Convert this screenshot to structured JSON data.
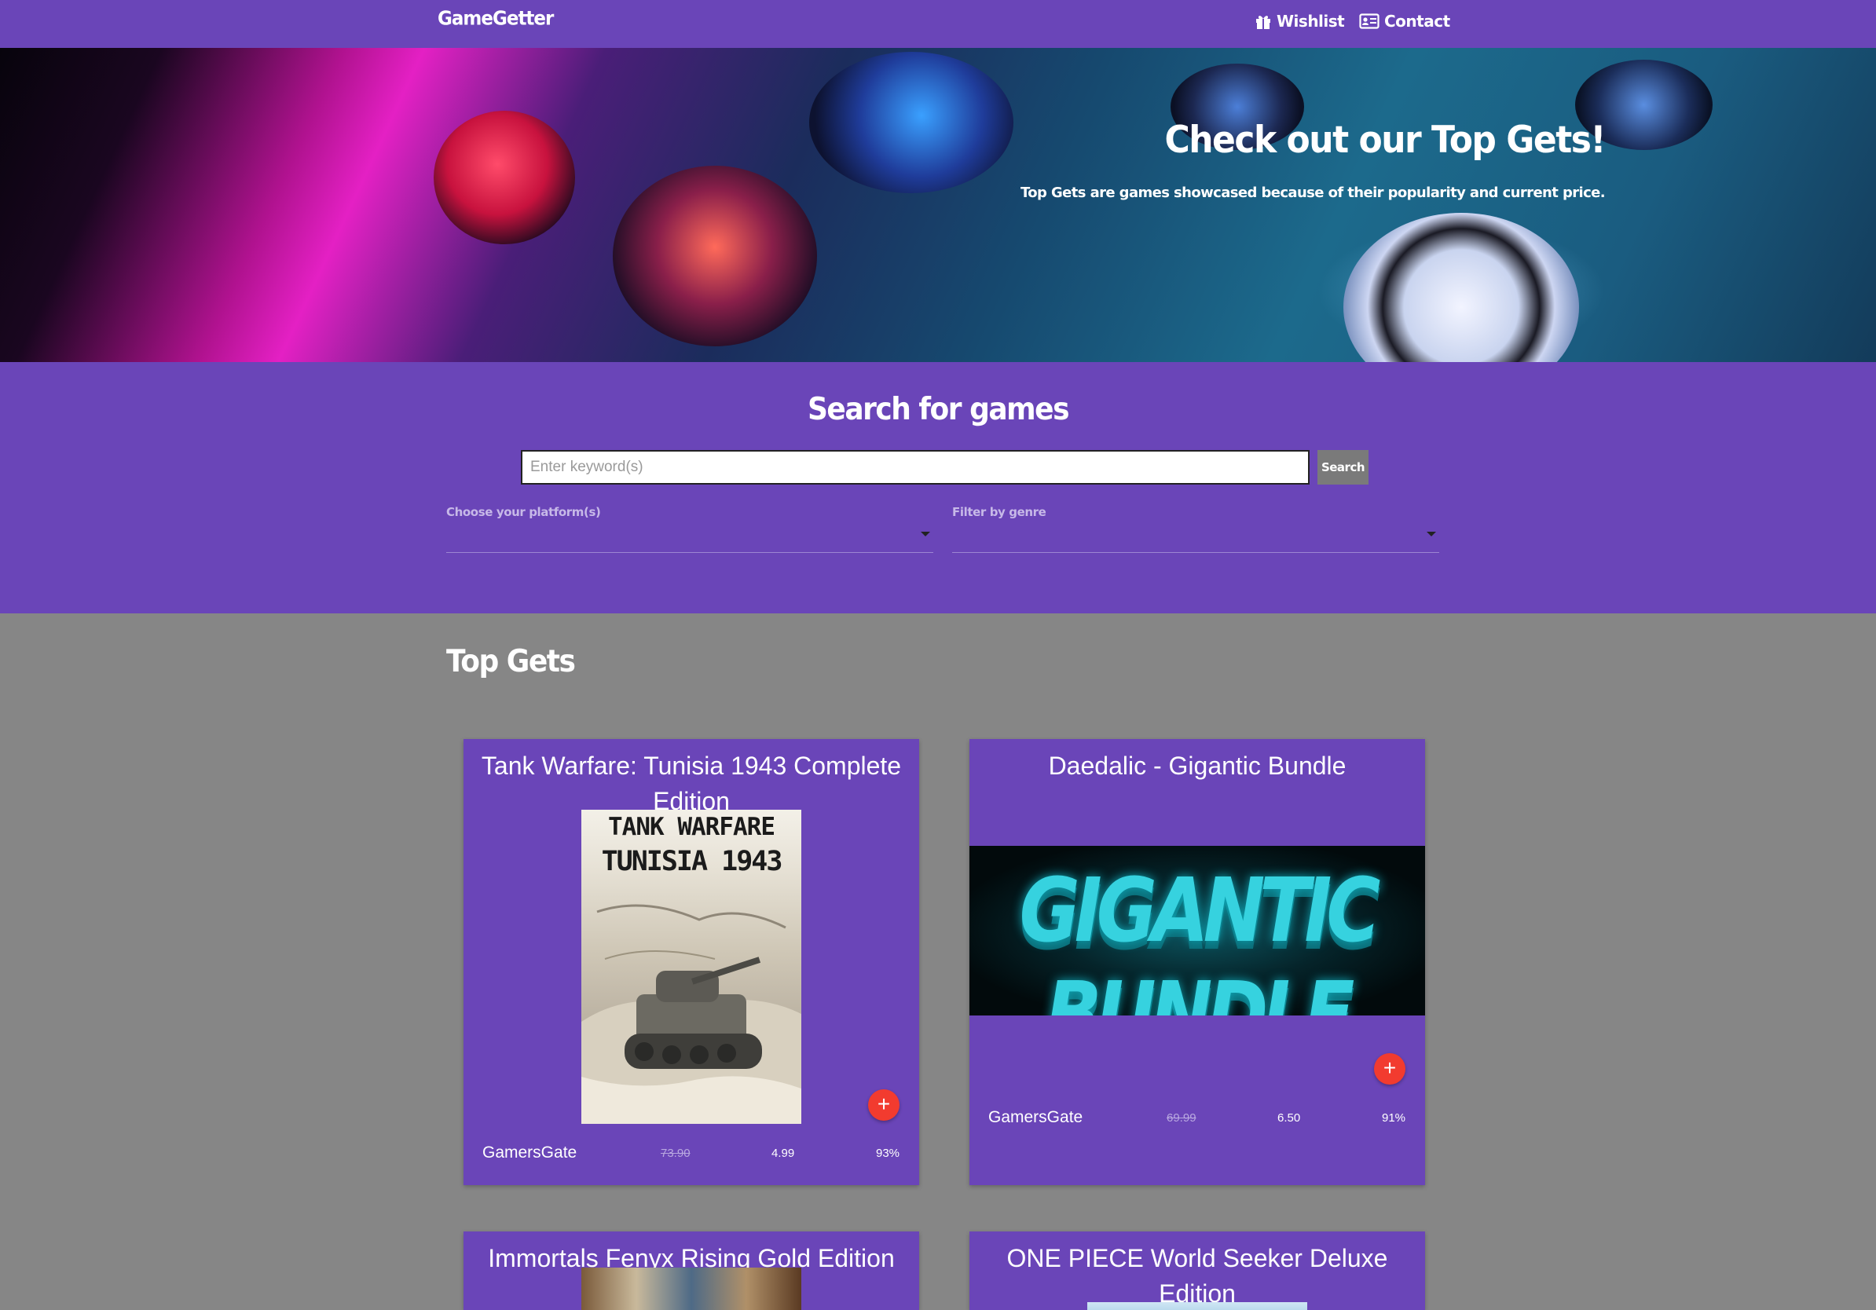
{
  "navbar": {
    "brand": "GameGetter",
    "links": [
      {
        "label": "Wishlist",
        "icon": "gift-icon"
      },
      {
        "label": "Contact",
        "icon": "contact-card-icon"
      }
    ]
  },
  "hero": {
    "title": "Check out our Top Gets!",
    "subtitle": "Top Gets are games showcased because of their popularity and current price."
  },
  "search": {
    "title": "Search for games",
    "placeholder": "Enter keyword(s)",
    "button_label": "Search",
    "platform_label": "Choose your platform(s)",
    "genre_label": "Filter by genre"
  },
  "top_gets": {
    "title": "Top Gets",
    "cards": [
      {
        "title": "Tank Warfare: Tunisia 1943 Complete Edition",
        "cover_text_1": "TANK WARFARE",
        "cover_text_2": "TUNISIA 1943",
        "store": "GamersGate",
        "old_price": "73.90",
        "new_price": "4.99",
        "discount": "93%"
      },
      {
        "title": "Daedalic - Gigantic Bundle",
        "cover_text_1": "GIGANTIC BUNDLE",
        "store": "GamersGate",
        "old_price": "69.99",
        "new_price": "6.50",
        "discount": "91%"
      },
      {
        "title": "Immortals Fenyx Rising Gold Edition"
      },
      {
        "title": "ONE PIECE World Seeker Deluxe Edition"
      }
    ],
    "add_symbol": "+"
  },
  "colors": {
    "primary": "#6a45b8",
    "page_background": "#868686",
    "add_button": "#f23b2f",
    "search_button": "#7a7a7a"
  }
}
